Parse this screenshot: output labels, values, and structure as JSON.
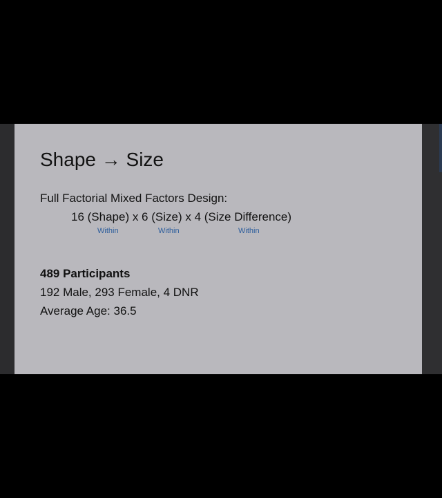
{
  "slide": {
    "title": "Shape → Size",
    "design_label": "Full Factorial Mixed Factors Design:",
    "design_formula": "16 (Shape) x 6 (Size) x 4 (Size Difference)",
    "factor_types": [
      "Within",
      "Within",
      "Within"
    ],
    "participants": "489 Participants",
    "demographics": "192 Male, 293 Female, 4 DNR",
    "average_age": "Average Age: 36.5"
  },
  "colors": {
    "background": "#000000",
    "slide_background": "#b9b8bd",
    "text": "#111111",
    "factor_tag": "#2c5d9c"
  }
}
